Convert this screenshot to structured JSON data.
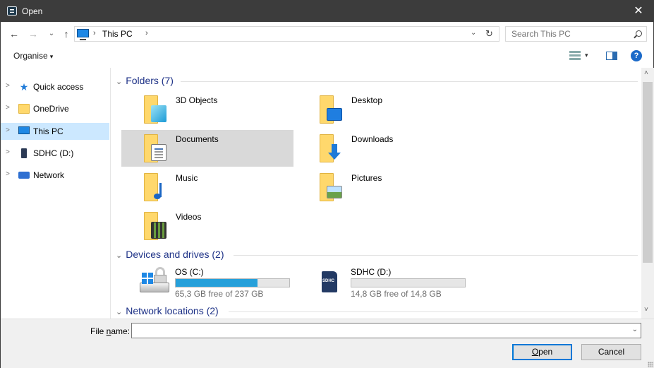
{
  "window": {
    "title": "Open",
    "close_symbol": "✕"
  },
  "nav": {
    "back": "←",
    "forward": "→",
    "recent": "⌄",
    "up": "↑"
  },
  "address": {
    "separator": "›",
    "crumb": "This PC",
    "dropdown": "⌄",
    "refresh": "↻"
  },
  "search": {
    "placeholder": "Search This PC"
  },
  "toolbar": {
    "organise": "Organise",
    "organise_caret": "▾",
    "view_caret": "▾",
    "help": "?"
  },
  "navpane": {
    "items": [
      {
        "label": "Quick access",
        "icon": "quick-access-star-icon"
      },
      {
        "label": "OneDrive",
        "icon": "onedrive-folder-icon"
      },
      {
        "label": "This PC",
        "icon": "this-pc-icon",
        "selected": true
      },
      {
        "label": "SDHC (D:)",
        "icon": "sd-card-icon"
      },
      {
        "label": "Network",
        "icon": "network-icon"
      }
    ],
    "chevron": ">"
  },
  "groups": {
    "folders": {
      "title": "Folders (7)",
      "items": [
        {
          "name": "3D Objects",
          "icon": "3d-objects-icon"
        },
        {
          "name": "Desktop",
          "icon": "desktop-icon"
        },
        {
          "name": "Documents",
          "icon": "documents-icon",
          "selected": true
        },
        {
          "name": "Downloads",
          "icon": "downloads-icon"
        },
        {
          "name": "Music",
          "icon": "music-icon"
        },
        {
          "name": "Pictures",
          "icon": "pictures-icon"
        },
        {
          "name": "Videos",
          "icon": "videos-icon"
        }
      ]
    },
    "devices": {
      "title": "Devices and drives (2)",
      "items": [
        {
          "name": "OS (C:)",
          "free": "65,3 GB free of 237 GB",
          "used_fraction": 0.72,
          "bar_color": "#26a0da"
        },
        {
          "name": "SDHC (D:)",
          "free": "14,8 GB free of 14,8 GB",
          "used_fraction": 0.0,
          "bar_color": "#26a0da"
        }
      ]
    },
    "network": {
      "title": "Network locations (2)"
    },
    "chevron": "⌄"
  },
  "scrollbar": {
    "up": "˄",
    "down": "˅"
  },
  "bottom": {
    "file_name_label_pre": "File ",
    "file_name_label_accel": "n",
    "file_name_label_post": "ame:",
    "file_name_value": "",
    "dropdown": "⌄",
    "open_label_accel": "O",
    "open_label_rest": "pen",
    "cancel_label": "Cancel"
  },
  "colors": {
    "titlebar": "#3c3c3c",
    "selection": "#cce8ff",
    "group_header": "#1e3287",
    "accent": "#0078d7"
  }
}
